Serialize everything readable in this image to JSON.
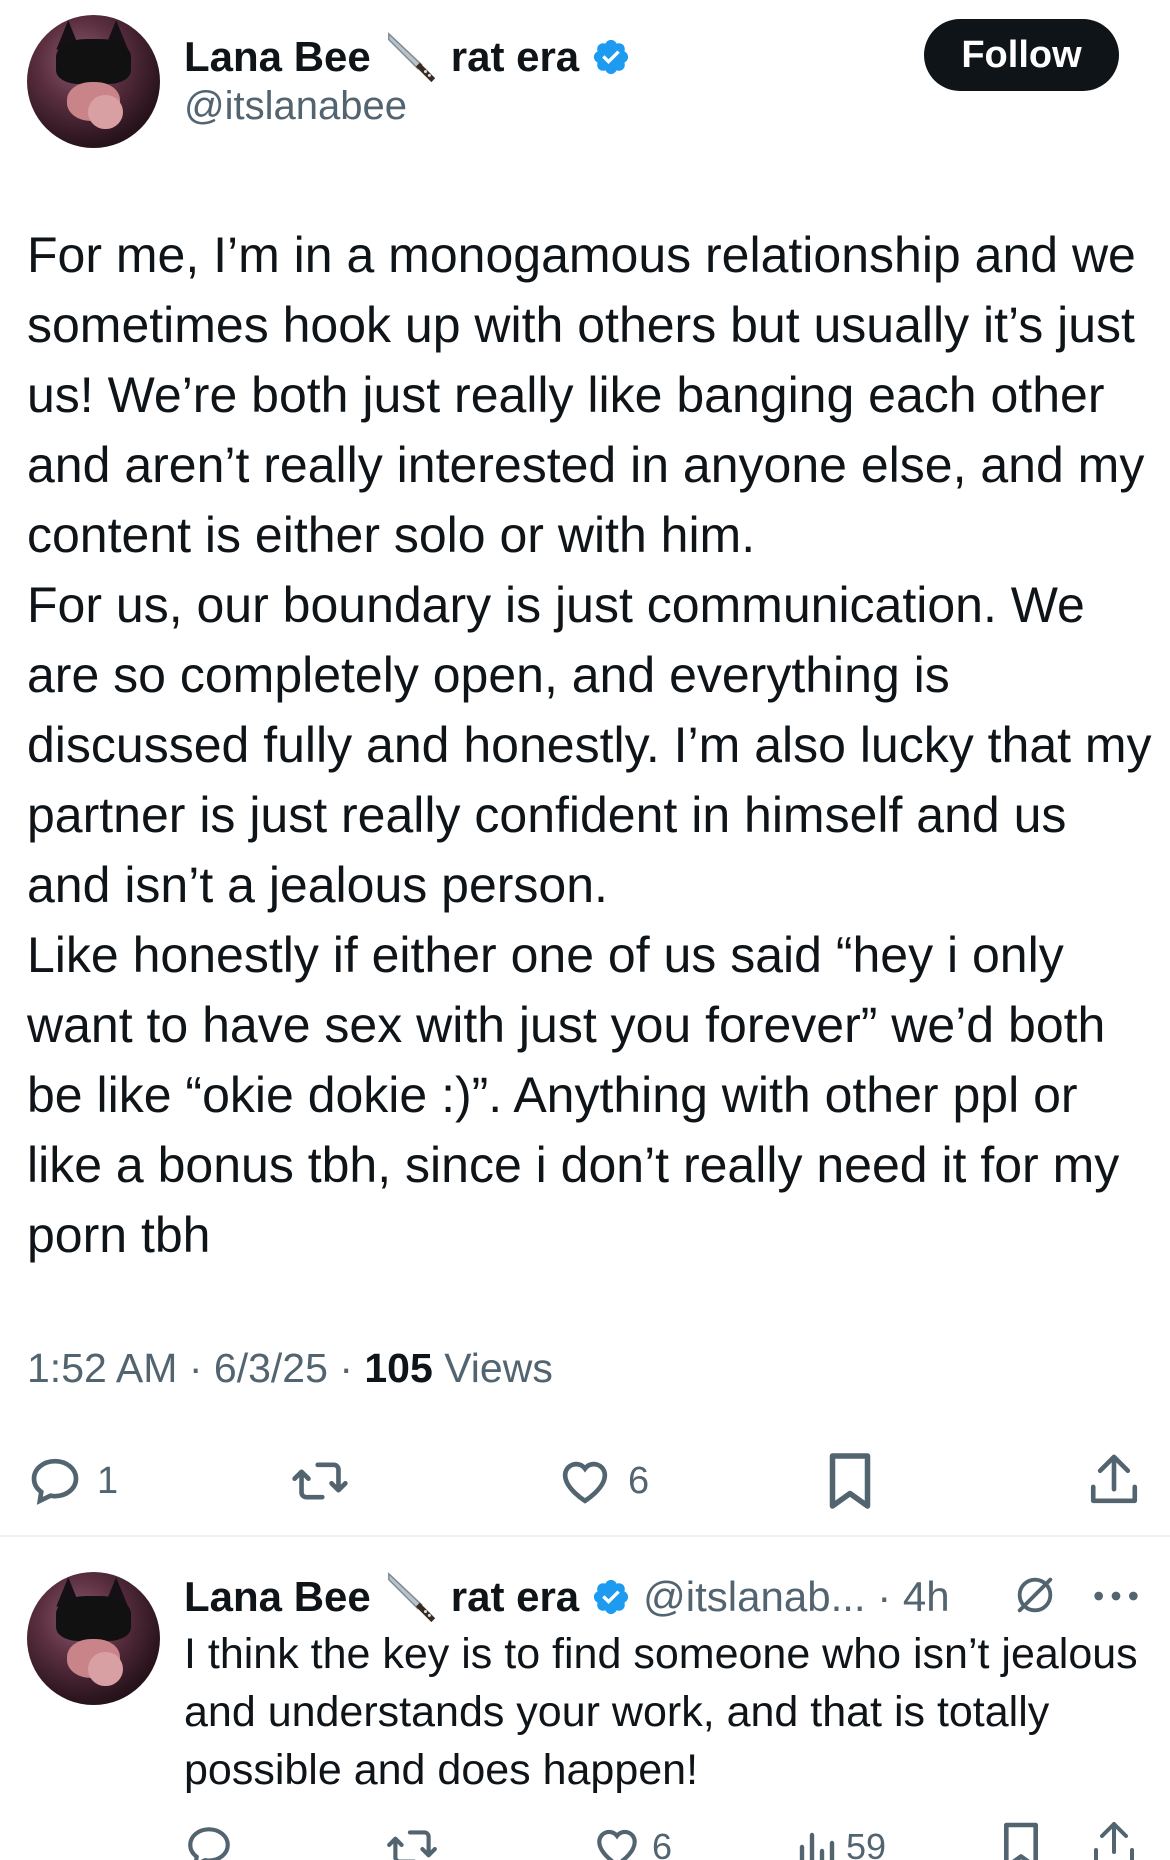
{
  "tweet": {
    "author": {
      "display_name": "Lana Bee",
      "name_suffix": "rat era",
      "emoji_icon": "kitchen-knife-icon",
      "handle": "@itslanabee",
      "verified": true
    },
    "follow_label": "Follow",
    "text": "For me, I’m in a monogamous relationship and we sometimes hook up with others but usually it’s just us! We’re both just really like banging each other and aren’t really interested in anyone else, and my content is either solo or with him.\nFor us, our boundary is just communication. We are so completely open, and everything is discussed fully and honestly. I’m also lucky that my partner is just really confident in himself and us and isn’t a jealous person.\nLike honestly if either one of us said “hey i only want to have sex with just you forever” we’d both be like “okie dokie :)”. Anything with other ppl or like a bonus tbh, since i don’t really need it for my porn tbh",
    "time": "1:52 AM",
    "date": "6/3/25",
    "views_count": "105",
    "views_label": "Views",
    "separator": "·",
    "actions": {
      "reply_count": "1",
      "repost_count": "",
      "like_count": "6"
    }
  },
  "reply": {
    "author": {
      "display_name": "Lana Bee",
      "name_suffix": "rat era",
      "emoji_icon": "kitchen-knife-icon",
      "handle_time": "@itslanab... · 4h",
      "verified": true
    },
    "text": "I think the key is to find someone who isn’t jealous and understands your work, and that is totally possible and does happen!",
    "actions": {
      "like_count": "6",
      "views_count": "59"
    }
  },
  "colors": {
    "text_primary": "#0f1419",
    "text_secondary": "#536471",
    "verified_blue": "#1d9bf0",
    "follow_bg": "#0f1419",
    "divider": "#eff3f4"
  }
}
